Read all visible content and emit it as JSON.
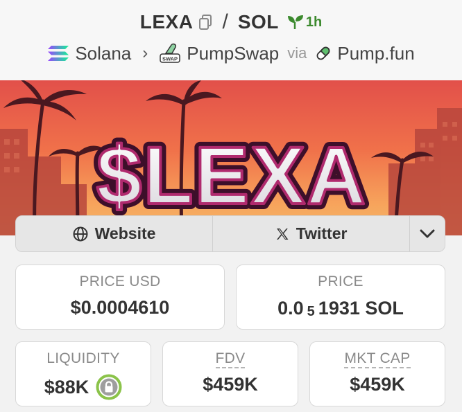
{
  "pair": {
    "base": "LEXA",
    "separator": "/",
    "quote": "SOL",
    "age": "1h"
  },
  "breadcrumb": {
    "chain": "Solana",
    "dex": "PumpSwap",
    "dex_badge": "SWAP",
    "via_label": "via",
    "launchpad": "Pump.fun"
  },
  "banner": {
    "text": "$LEXA"
  },
  "links": {
    "website": "Website",
    "twitter": "Twitter"
  },
  "stats": {
    "price_usd_label": "PRICE USD",
    "price_usd_value": "$0.0004610",
    "price_label": "PRICE",
    "price_prefix": "0.0",
    "price_zeros": "5",
    "price_digits": "1931 SOL",
    "liquidity_label": "LIQUIDITY",
    "liquidity_value": "$88K",
    "fdv_label": "FDV",
    "fdv_value": "$459K",
    "mktcap_label": "MKT CAP",
    "mktcap_value": "$459K"
  },
  "colors": {
    "age_green": "#3c8a2e",
    "lock_green": "#8bc34a"
  }
}
